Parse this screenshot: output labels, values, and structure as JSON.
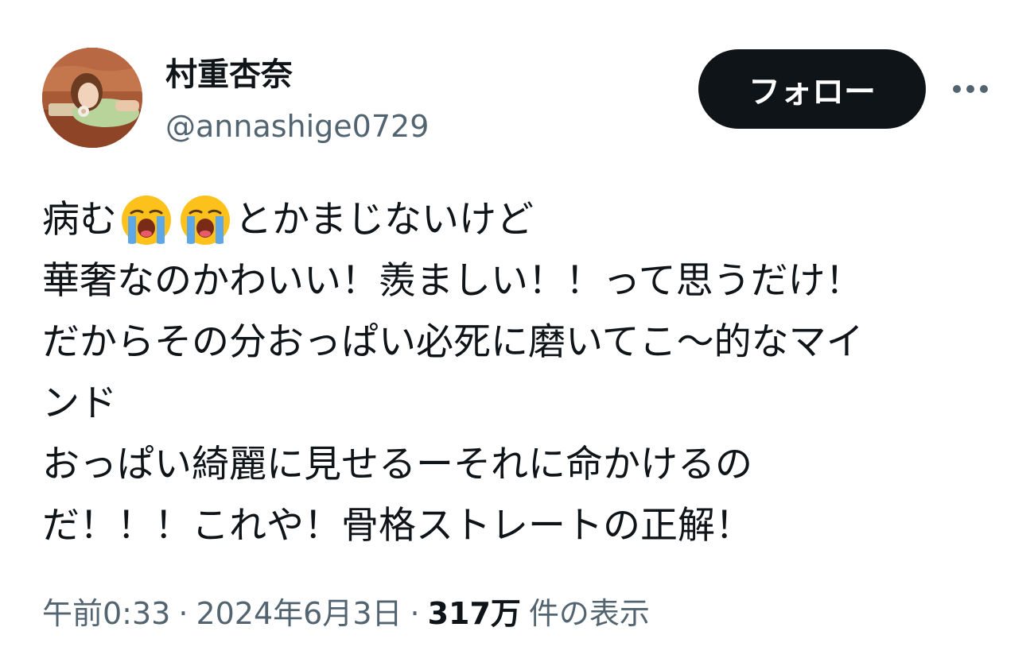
{
  "user": {
    "display_name": "村重杏奈",
    "handle": "@annashige0729"
  },
  "actions": {
    "follow_label": "フォロー",
    "more_icon": "more-horizontal-icon"
  },
  "tweet": {
    "line1_before": "病む",
    "line1_emoji": "loudly-crying-face",
    "line1_after": "とかまじないけど",
    "line2": "華奢なのかわいい！羨ましい！！って思うだけ！",
    "line3": "だからその分おっぱい必死に磨いてこ〜的なマイ",
    "line4": "ンド",
    "line5": "おっぱい綺麗に見せるーそれに命かけるの",
    "line6": "だ！！！これや！骨格ストレートの正解！"
  },
  "meta": {
    "time": "午前0:33",
    "separator": "·",
    "date": "2024年6月3日",
    "views_count": "317万",
    "views_label": "件の表示"
  },
  "colors": {
    "text_primary": "#0f1419",
    "text_secondary": "#536471",
    "button_bg": "#0f1419",
    "button_text": "#ffffff",
    "emoji_face": "#fcc21b",
    "emoji_tears": "#5ea7e6"
  }
}
